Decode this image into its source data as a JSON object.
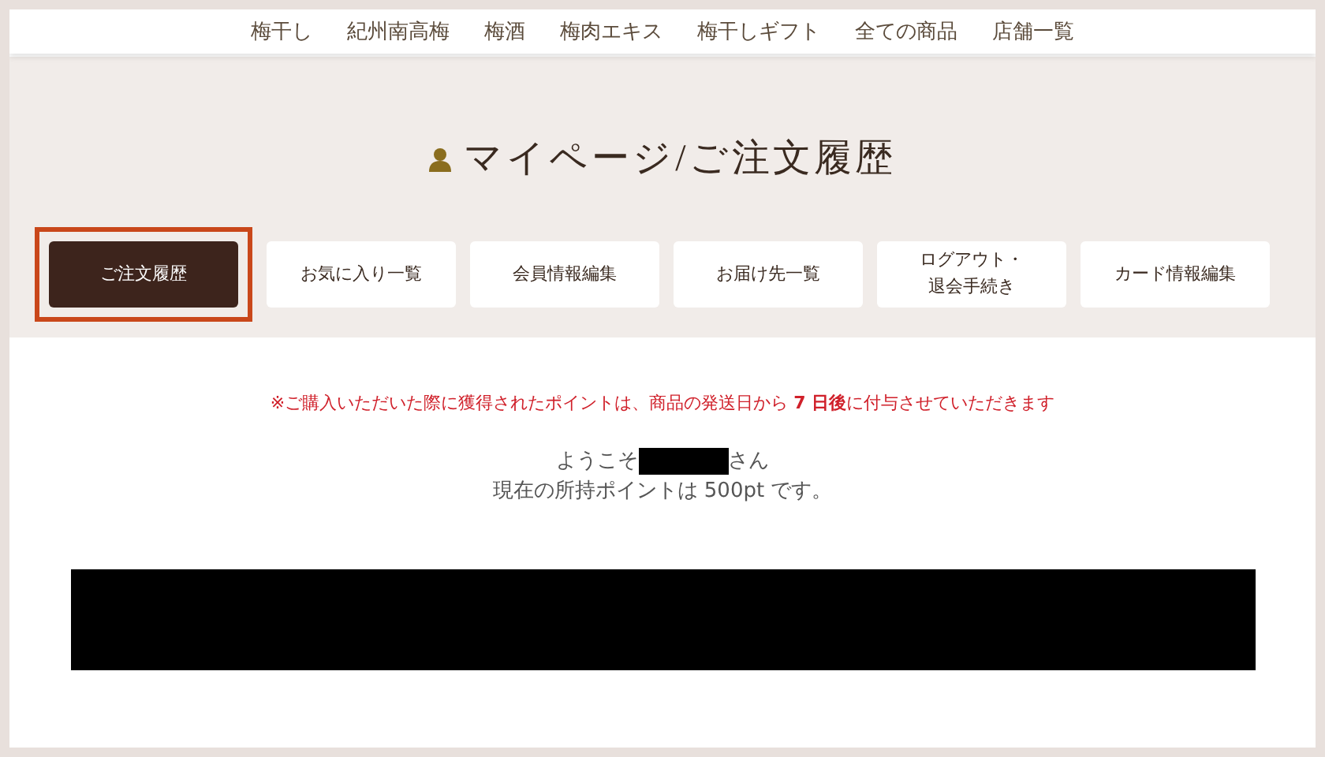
{
  "nav": [
    "梅干し",
    "紀州南高梅",
    "梅酒",
    "梅肉エキス",
    "梅干しギフト",
    "全ての商品",
    "店舗一覧"
  ],
  "title": "マイページ/ご注文履歴",
  "tabs": [
    {
      "label": "ご注文履歴",
      "selected": true
    },
    {
      "label": "お気に入り一覧",
      "selected": false
    },
    {
      "label": "会員情報編集",
      "selected": false
    },
    {
      "label": "お届け先一覧",
      "selected": false
    },
    {
      "label": "ログアウト・",
      "label_line_2": "退会手続き",
      "selected": false
    },
    {
      "label": "カード情報編集",
      "selected": false
    }
  ],
  "notice": "※ご購入いただいた際に獲得されたポイントは、商品の発送日から **7 日後**に付与させていただきます",
  "welcome_prefix": "ようこそ",
  "welcome_suffix": "さん",
  "points": "現在の所持ポイントは 500pt です。"
}
